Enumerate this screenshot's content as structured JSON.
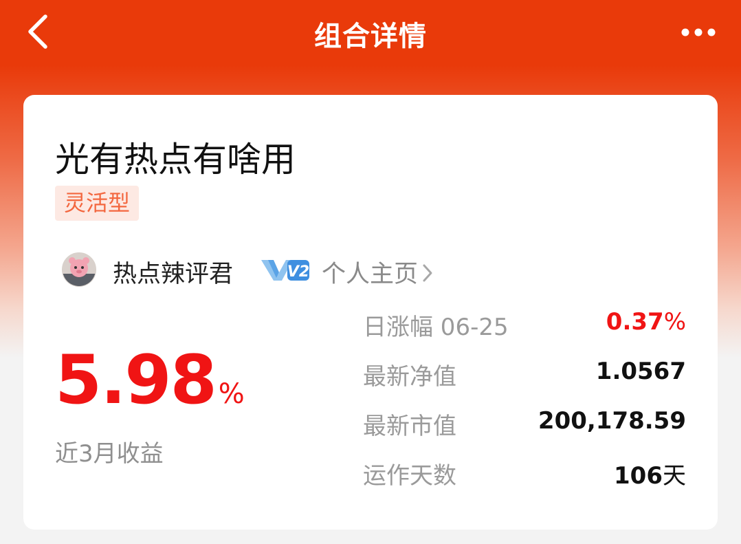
{
  "nav": {
    "title": "组合详情",
    "back_icon": "chevron-left-icon",
    "more_icon": "more-dots-icon"
  },
  "portfolio": {
    "name": "光有热点有啥用",
    "tag": "灵活型"
  },
  "author": {
    "name": "热点辣评君",
    "level_badge": "V2",
    "homepage_label": "个人主页"
  },
  "returns": {
    "value": "5.98",
    "unit": "%",
    "label": "近3月收益"
  },
  "stats": [
    {
      "label": "日涨幅 06-25",
      "value": "0.37",
      "unit": "%"
    },
    {
      "label": "最新净值",
      "value": "1.0567",
      "unit": ""
    },
    {
      "label": "最新市值",
      "value": "200,178.59",
      "unit": ""
    },
    {
      "label": "运作天数",
      "value": "106",
      "unit": "天"
    }
  ],
  "colors": {
    "header": "#e93a0a",
    "accent_red": "#f01414",
    "tag_bg": "#fde9e3",
    "tag_text": "#f3673f",
    "badge_blue": "#3f8fe0"
  }
}
